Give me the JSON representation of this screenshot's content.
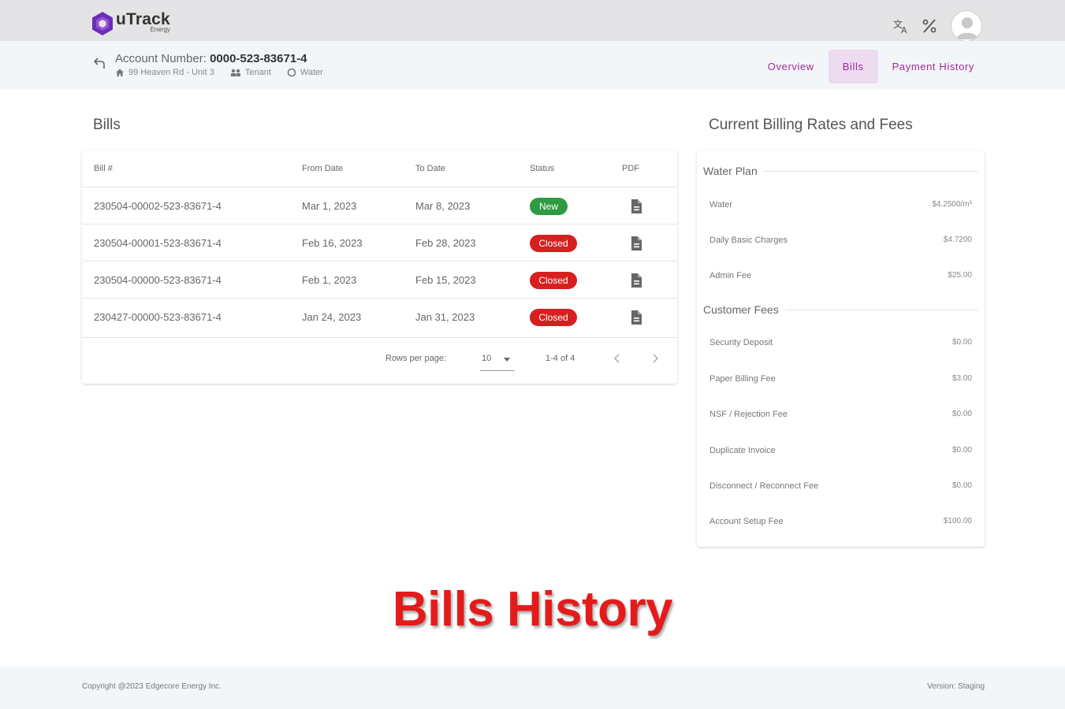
{
  "header": {
    "logo_text": "uTrack",
    "logo_sub": "Energy",
    "icons": [
      "translate-icon",
      "percent-icon",
      "account-avatar"
    ]
  },
  "account": {
    "label": "Account Number:",
    "number": "0000-523-83671-4",
    "address": "99 Heaven Rd - Unit 3",
    "role": "Tenant",
    "utility": "Water"
  },
  "tabs": [
    {
      "label": "Overview",
      "active": false
    },
    {
      "label": "Bills",
      "active": true
    },
    {
      "label": "Payment History",
      "active": false
    }
  ],
  "bills": {
    "title": "Bills",
    "columns": [
      "Bill #",
      "From Date",
      "To Date",
      "Status",
      "PDF"
    ],
    "rows": [
      {
        "bill": "230504-00002-523-83671-4",
        "from": "Mar 1, 2023",
        "to": "Mar 8, 2023",
        "status": "New"
      },
      {
        "bill": "230504-00001-523-83671-4",
        "from": "Feb 16, 2023",
        "to": "Feb 28, 2023",
        "status": "Closed"
      },
      {
        "bill": "230504-00000-523-83671-4",
        "from": "Feb 1, 2023",
        "to": "Feb 15, 2023",
        "status": "Closed"
      },
      {
        "bill": "230427-00000-523-83671-4",
        "from": "Jan 24, 2023",
        "to": "Jan 31, 2023",
        "status": "Closed"
      }
    ],
    "pagination": {
      "rows_per_page_label": "Rows per page:",
      "rows_per_page": "10",
      "range": "1-4 of 4"
    }
  },
  "rates": {
    "title": "Current Billing Rates and Fees",
    "water_plan": {
      "heading": "Water Plan",
      "items": [
        {
          "label": "Water",
          "value": "$4.2500/m³"
        },
        {
          "label": "Daily Basic Charges",
          "value": "$4.7200"
        },
        {
          "label": "Admin Fee",
          "value": "$25.00"
        }
      ]
    },
    "customer_fees": {
      "heading": "Customer Fees",
      "items": [
        {
          "label": "Security Deposit",
          "value": "$0.00"
        },
        {
          "label": "Paper Billing Fee",
          "value": "$3.00"
        },
        {
          "label": "NSF / Rejection Fee",
          "value": "$0.00"
        },
        {
          "label": "Duplicate Invoice",
          "value": "$0.00"
        },
        {
          "label": "Disconnect / Reconnect Fee",
          "value": "$0.00"
        },
        {
          "label": "Account Setup Fee",
          "value": "$100.00"
        }
      ]
    }
  },
  "caption": "Bills History",
  "footer": {
    "copyright": "Copyright @2023 Edgecore Energy Inc.",
    "version": "Version: Staging"
  },
  "colors": {
    "accent": "#a0279d",
    "status_new": "#2e9b43",
    "status_closed": "#d62020",
    "caption": "#e41b1b"
  }
}
